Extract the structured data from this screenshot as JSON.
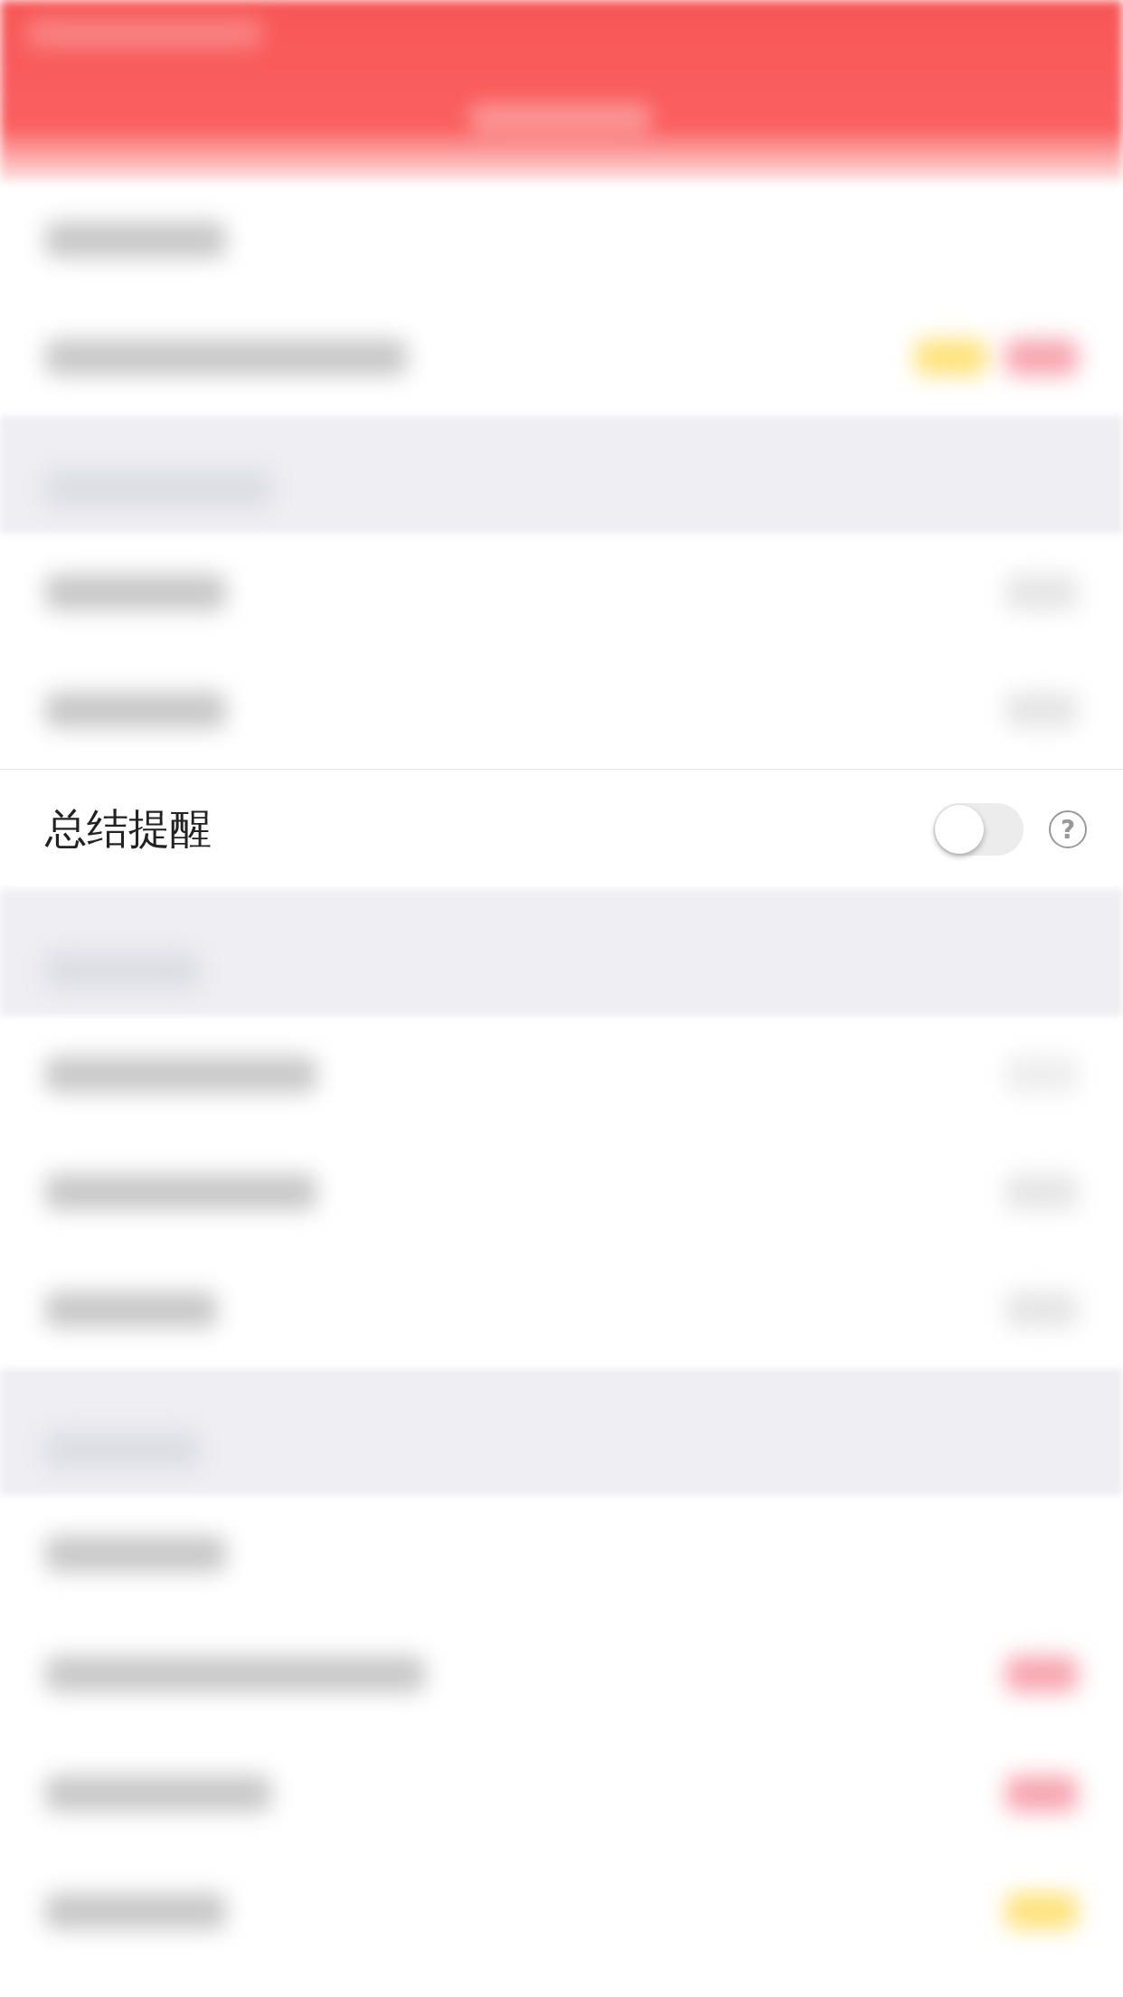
{
  "setting": {
    "label": "总结提醒",
    "on": false,
    "help": "?"
  }
}
